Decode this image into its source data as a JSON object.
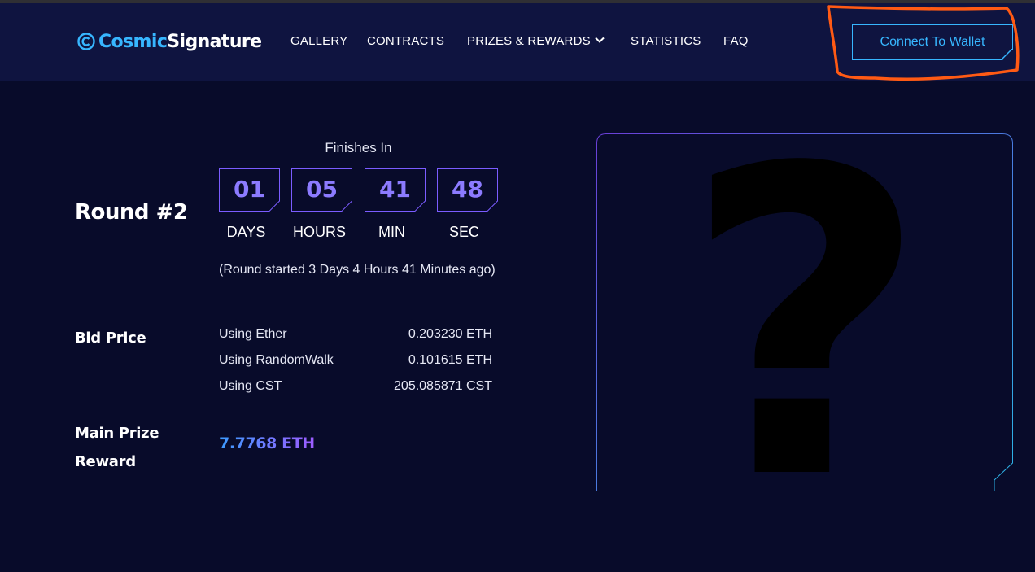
{
  "brand": {
    "part1": "Cosmic",
    "part2": "Signature",
    "colors": {
      "accent": "#37b6ff",
      "background": "#080b2a",
      "header": "#0f1440"
    }
  },
  "nav": {
    "gallery": "GALLERY",
    "contracts": "CONTRACTS",
    "prizes": "PRIZES & REWARDS",
    "statistics": "STATISTICS",
    "faq": "FAQ"
  },
  "wallet": {
    "label": "Connect To Wallet"
  },
  "round": {
    "title": "Round #2",
    "finishes_label": "Finishes In",
    "countdown": [
      {
        "value": "01",
        "unit": "DAYS"
      },
      {
        "value": "05",
        "unit": "HOURS"
      },
      {
        "value": "41",
        "unit": "MIN"
      },
      {
        "value": "48",
        "unit": "SEC"
      }
    ],
    "started_text": "(Round started 3 Days 4 Hours 41 Minutes ago)"
  },
  "bid": {
    "label": "Bid Price",
    "rows": [
      {
        "label": "Using Ether",
        "value": "0.203230 ETH"
      },
      {
        "label": "Using RandomWalk",
        "value": "0.101615 ETH"
      },
      {
        "label": "Using CST",
        "value": "205.085871 CST"
      }
    ]
  },
  "prize": {
    "label_line1": "Main Prize",
    "label_line2": "Reward",
    "value": "7.7768 ETH"
  },
  "nft": {
    "placeholder": "?"
  },
  "icons": [
    "cosmic-logo-icon",
    "chevron-down-icon"
  ]
}
